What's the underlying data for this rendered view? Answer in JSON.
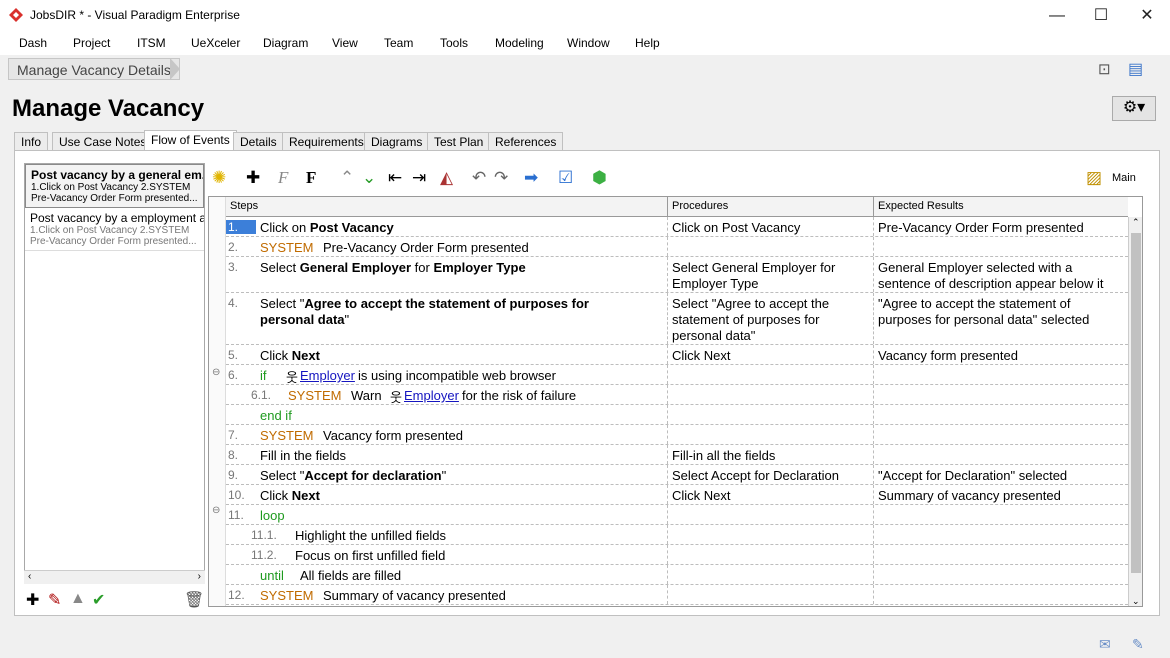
{
  "window": {
    "title": "JobsDIR * - Visual Paradigm Enterprise",
    "minimize": "—",
    "maximize": "☐",
    "close": "✕"
  },
  "menu": [
    "Dash",
    "Project",
    "ITSM",
    "UeXceler",
    "Diagram",
    "View",
    "Team",
    "Tools",
    "Modeling",
    "Window",
    "Help"
  ],
  "breadcrumb": "Manage Vacancy Details",
  "page_title": "Manage Vacancy",
  "tabs": [
    "Info",
    "Use Case Notes",
    "Flow of Events",
    "Details",
    "Requirements",
    "Diagrams",
    "Test Plan",
    "References"
  ],
  "active_tab": "Flow of Events",
  "scenarios": [
    {
      "title": "Post vacancy by a general em...",
      "line1": "1.Click on Post Vacancy 2.SYSTEM",
      "line2": "Pre-Vacancy Order Form presented..."
    },
    {
      "title": "Post vacancy by a employment ager",
      "line1": "1.Click on Post Vacancy 2.SYSTEM",
      "line2": "Pre-Vacancy Order Form presented..."
    }
  ],
  "toolbar": {
    "main_label": "Main"
  },
  "columns": {
    "steps": "Steps",
    "procedures": "Procedures",
    "expected": "Expected Results"
  },
  "rows": [
    {
      "num": "1.",
      "pre": "Click on ",
      "bold": "Post Vacancy",
      "post": "",
      "proc": "Click on Post Vacancy",
      "exp": "Pre-Vacancy Order Form presented"
    },
    {
      "num": "2.",
      "sys": "SYSTEM",
      "text": "Pre-Vacancy Order Form presented",
      "proc": "",
      "exp": ""
    },
    {
      "num": "3.",
      "pre": "Select ",
      "bold": "General Employer",
      "mid": " for ",
      "bold2": "Employer Type",
      "proc": "Select General Employer for Employer Type",
      "exp": "General Employer selected with a sentence of description appear below it"
    },
    {
      "num": "4.",
      "pre": "Select \"",
      "bold": "Agree to accept the statement of purposes for personal data",
      "post": "\"",
      "proc": "Select \"Agree to accept the statement of purposes for personal data\"",
      "exp": "\"Agree to accept the statement of purposes for personal data\" selected"
    },
    {
      "num": "5.",
      "pre": "Click ",
      "bold": "Next",
      "proc": "Click Next",
      "exp": "Vacancy form presented"
    },
    {
      "num": "6.",
      "kw": "if",
      "actor": "Employer",
      "text": "is using incompatible web browser",
      "proc": "",
      "exp": ""
    },
    {
      "num": "6.1.",
      "sys": "SYSTEM",
      "pre": "Warn",
      "actor": "Employer",
      "text": "for the risk of failure",
      "proc": "",
      "exp": ""
    },
    {
      "num": "",
      "kw": "end if",
      "proc": "",
      "exp": ""
    },
    {
      "num": "7.",
      "sys": "SYSTEM",
      "text": "Vacancy form presented",
      "proc": "",
      "exp": ""
    },
    {
      "num": "8.",
      "text": "Fill in the fields",
      "proc": "Fill-in all the fields",
      "exp": ""
    },
    {
      "num": "9.",
      "pre": "Select \"",
      "bold": "Accept for declaration",
      "post": "\"",
      "proc": "Select Accept for Declaration",
      "exp": "\"Accept for Declaration\" selected"
    },
    {
      "num": "10.",
      "pre": "Click ",
      "bold": "Next",
      "proc": "Click Next",
      "exp": "Summary of vacancy presented"
    },
    {
      "num": "11.",
      "kw": "loop",
      "proc": "",
      "exp": ""
    },
    {
      "num": "11.1.",
      "text": "Highlight the unfilled fields",
      "proc": "",
      "exp": ""
    },
    {
      "num": "11.2.",
      "text": "Focus on first unfilled field",
      "proc": "",
      "exp": ""
    },
    {
      "num": "",
      "kw": "until",
      "text": "All fields are filled",
      "proc": "",
      "exp": ""
    },
    {
      "num": "12.",
      "sys": "SYSTEM",
      "text": "Summary of vacancy presented",
      "proc": "",
      "exp": ""
    }
  ]
}
